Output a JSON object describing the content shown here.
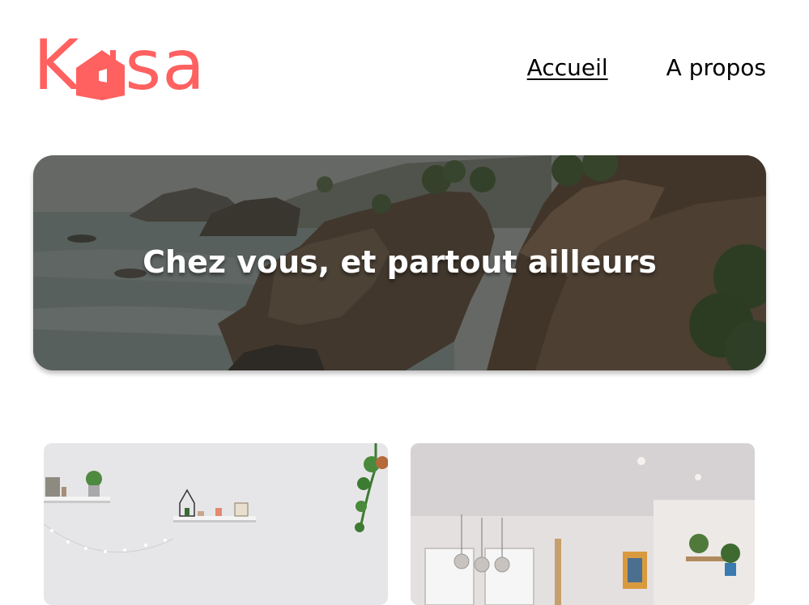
{
  "header": {
    "logo": {
      "letters_before": "K",
      "letters_after": "sa",
      "alt": "Kasa",
      "icon": "house-icon",
      "color": "#ff6060"
    },
    "nav": [
      {
        "label": "Accueil",
        "active": true
      },
      {
        "label": "A propos",
        "active": false
      }
    ]
  },
  "banner": {
    "title": "Chez vous, et partout ailleurs"
  },
  "listings": [
    {
      "name": "listing-card-1",
      "image": "bright-room-with-shelves-and-plants"
    },
    {
      "name": "listing-card-2",
      "image": "loft-with-pendant-lamps-and-artwork"
    }
  ],
  "colors": {
    "accent": "#ff6060",
    "text": "#000000",
    "background": "#ffffff"
  }
}
